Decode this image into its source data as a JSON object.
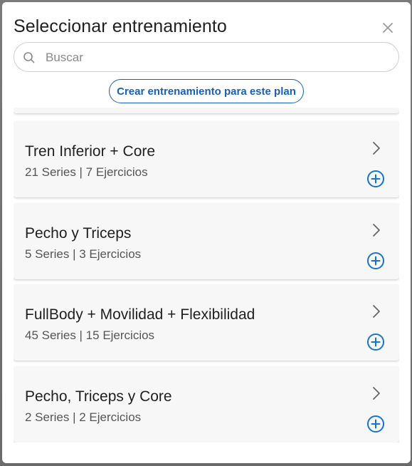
{
  "modal": {
    "title": "Seleccionar entrenamiento",
    "close_icon": "close-icon"
  },
  "search": {
    "placeholder": "Buscar",
    "value": "",
    "icon": "search-icon"
  },
  "create_button": {
    "label": "Crear entrenamiento para este plan"
  },
  "workouts": [
    {
      "name": "Tren Inferior + Core",
      "meta": "21 Series | 7 Ejercicios"
    },
    {
      "name": "Pecho y Triceps",
      "meta": "5 Series | 3 Ejercicios"
    },
    {
      "name": "FullBody + Movilidad + Flexibilidad",
      "meta": "45 Series | 15 Ejercicios"
    },
    {
      "name": "Pecho, Triceps y Core",
      "meta": "2 Series | 2 Ejercicios"
    }
  ],
  "colors": {
    "accent": "#1b5fb5",
    "card_bg": "#f7f7f7",
    "add_icon": "#1a73c9"
  }
}
